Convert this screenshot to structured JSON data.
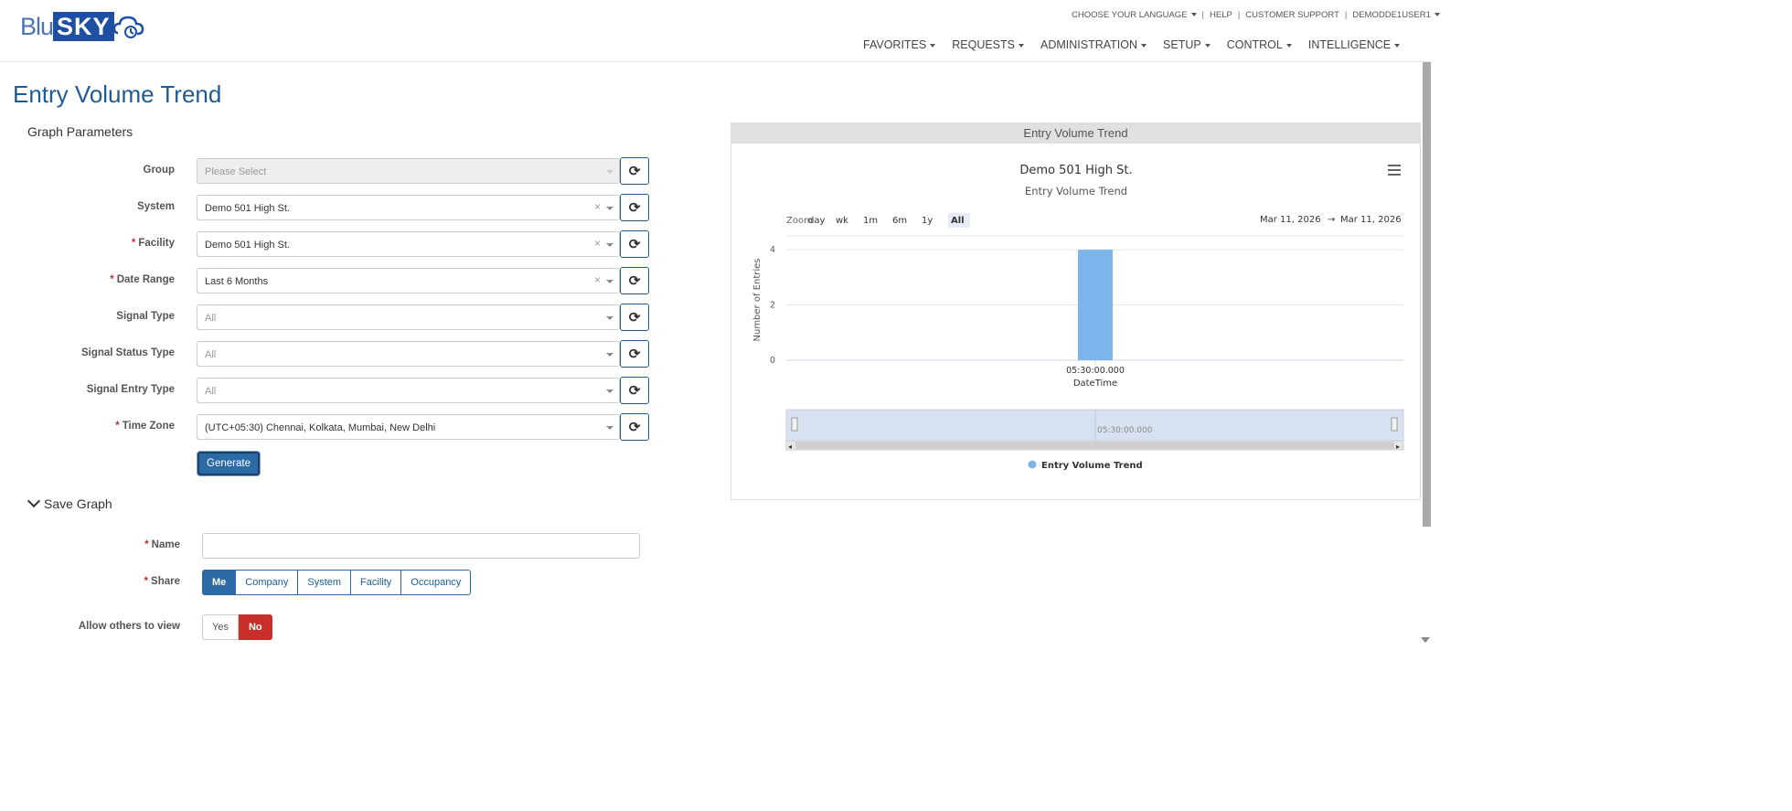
{
  "brand": {
    "part1": "Blu",
    "part2": "SKY"
  },
  "util_nav": {
    "language": "CHOOSE YOUR LANGUAGE",
    "help": "HELP",
    "support": "CUSTOMER SUPPORT",
    "user": "DEMODDE1USER1"
  },
  "main_nav": [
    "FAVORITES",
    "REQUESTS",
    "ADMINISTRATION",
    "SETUP",
    "CONTROL",
    "INTELLIGENCE"
  ],
  "page_title": "Entry Volume Trend",
  "section_title": "Graph Parameters",
  "fields": [
    {
      "label": "Group",
      "required": false,
      "value": "Please Select",
      "placeholder": true,
      "clearable": false,
      "disabled": true
    },
    {
      "label": "System",
      "required": false,
      "value": "Demo 501 High St.",
      "placeholder": false,
      "clearable": true,
      "disabled": false
    },
    {
      "label": "Facility",
      "required": true,
      "value": "Demo 501 High St.",
      "placeholder": false,
      "clearable": true,
      "disabled": false
    },
    {
      "label": "Date Range",
      "required": true,
      "value": "Last 6 Months",
      "placeholder": false,
      "clearable": true,
      "disabled": false
    },
    {
      "label": "Signal Type",
      "required": false,
      "value": "All",
      "placeholder": true,
      "clearable": false,
      "disabled": false
    },
    {
      "label": "Signal Status Type",
      "required": false,
      "value": "All",
      "placeholder": true,
      "clearable": false,
      "disabled": false
    },
    {
      "label": "Signal Entry Type",
      "required": false,
      "value": "All",
      "placeholder": true,
      "clearable": false,
      "disabled": false
    },
    {
      "label": "Time Zone",
      "required": true,
      "value": "(UTC+05:30) Chennai, Kolkata, Mumbai, New Delhi",
      "placeholder": false,
      "clearable": false,
      "disabled": false
    }
  ],
  "generate_label": "Generate",
  "save": {
    "toggle_label": "Save Graph",
    "name_label": "Name",
    "share_label": "Share",
    "share_options": [
      "Me",
      "Company",
      "System",
      "Facility",
      "Occupancy"
    ],
    "share_selected": "Me",
    "allow_label": "Allow others to view",
    "yes_label": "Yes",
    "no_label": "No"
  },
  "chart_panel": {
    "header": "Entry Volume Trend",
    "zoom_label": "Zoom",
    "zoom_buttons": [
      "day",
      "wk",
      "1m",
      "6m",
      "1y",
      "All"
    ],
    "zoom_selected": "All",
    "range_from": "Mar 11, 2026",
    "range_arrow": "→",
    "range_to": "Mar 11, 2026",
    "navigator_label": "05:30:00.000"
  },
  "chart_data": {
    "type": "bar",
    "title": "Demo 501 High St.",
    "subtitle": "Entry Volume Trend",
    "xlabel": "DateTime",
    "ylabel": "Number of Entries",
    "categories": [
      "05:30:00.000"
    ],
    "series": [
      {
        "name": "Entry Volume Trend",
        "values": [
          4
        ],
        "color": "#7cb5ec"
      }
    ],
    "yticks": [
      0,
      2,
      4
    ],
    "ylim": [
      0,
      4.5
    ],
    "grid": true,
    "legend_position": "bottom-center"
  },
  "colors": {
    "accent": "#1e5c96",
    "primary_button": "#2b6aa5",
    "danger": "#c9302c",
    "bar": "#7cb5ec"
  }
}
